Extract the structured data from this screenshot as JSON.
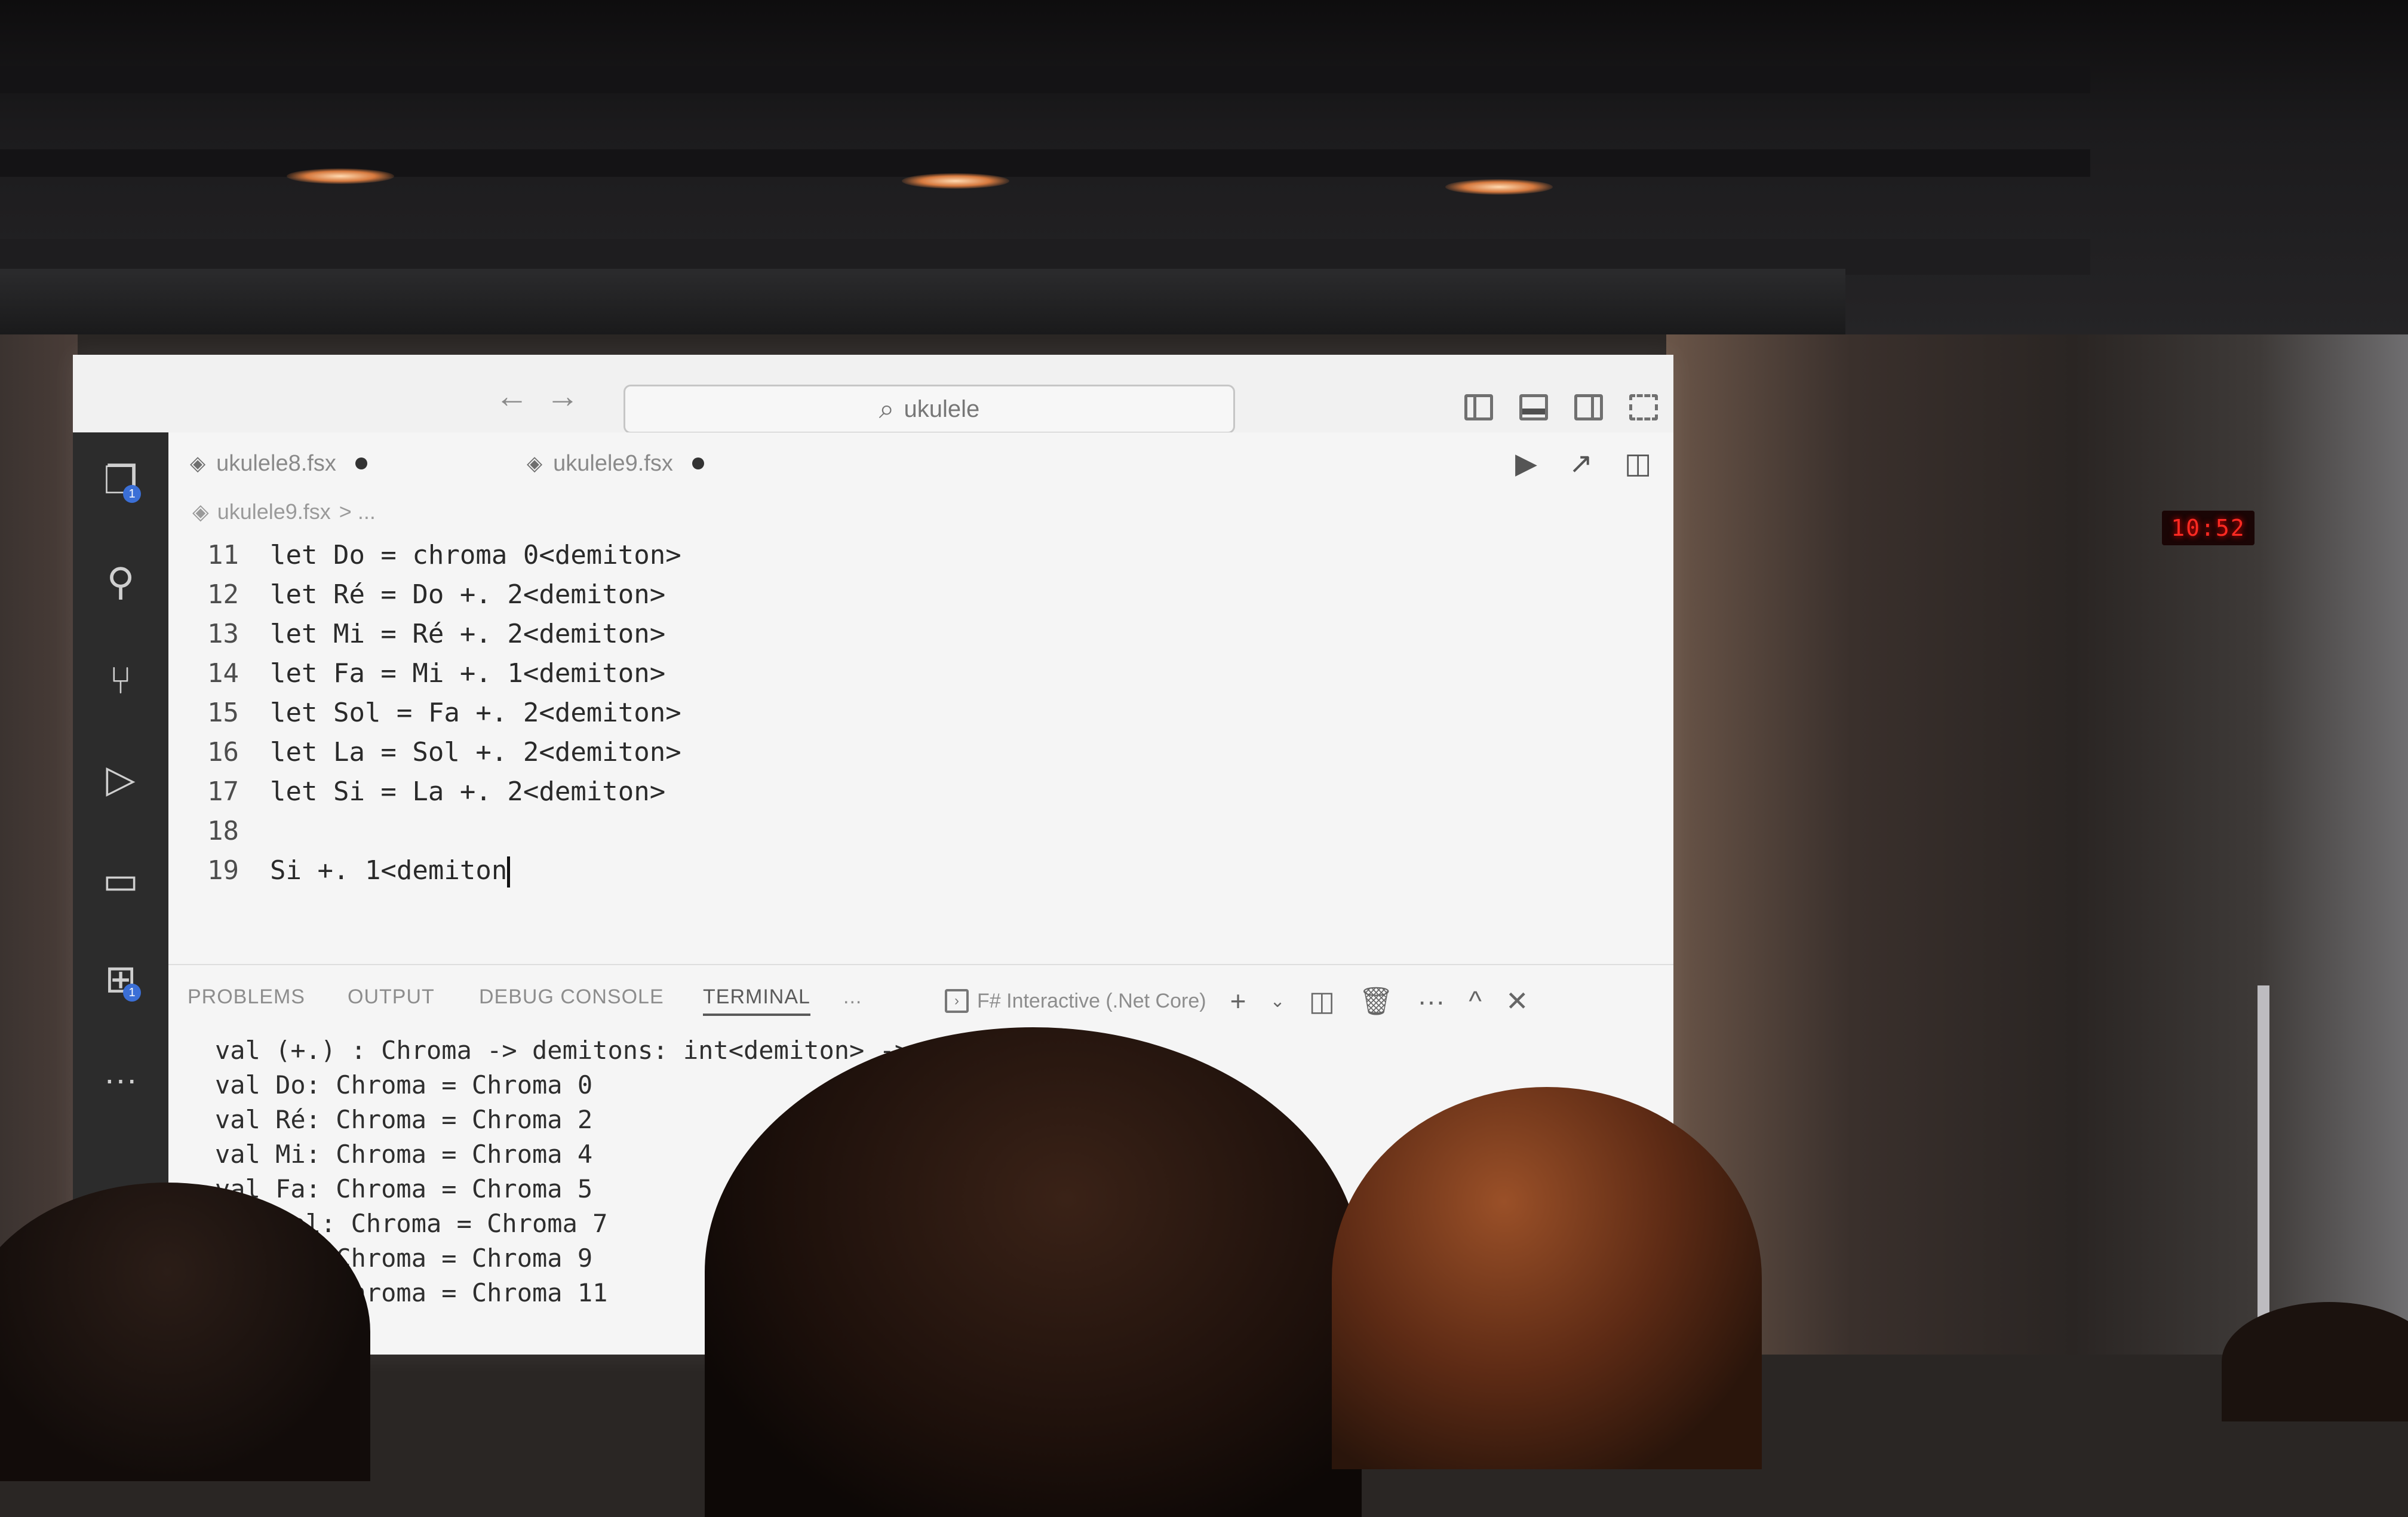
{
  "clock_display": "10:52",
  "titlebar": {
    "back_arrow": "←",
    "forward_arrow": "→",
    "search_text": "ukulele"
  },
  "tabs": [
    {
      "label": "ukulele8.fsx",
      "modified": true
    },
    {
      "label": "ukulele9.fsx",
      "modified": true
    }
  ],
  "breadcrumb": {
    "file": "ukulele9.fsx",
    "separator": "> ..."
  },
  "activity_badges": {
    "explorer": "1",
    "extensions": "1"
  },
  "code_lines": [
    {
      "n": "11",
      "text": "let Do = chroma 0<demiton>"
    },
    {
      "n": "12",
      "text": "let Ré = Do +. 2<demiton>"
    },
    {
      "n": "13",
      "text": "let Mi = Ré +. 2<demiton>"
    },
    {
      "n": "14",
      "text": "let Fa = Mi +. 1<demiton>"
    },
    {
      "n": "15",
      "text": "let Sol = Fa +. 2<demiton>"
    },
    {
      "n": "16",
      "text": "let La = Sol +. 2<demiton>"
    },
    {
      "n": "17",
      "text": "let Si = La +. 2<demiton>"
    },
    {
      "n": "18",
      "text": ""
    },
    {
      "n": "19",
      "text": "Si +. 1<demiton"
    }
  ],
  "panel": {
    "tabs": [
      "PROBLEMS",
      "OUTPUT",
      "DEBUG CONSOLE",
      "TERMINAL",
      "..."
    ],
    "active_tab": "TERMINAL",
    "terminal_name": "F# Interactive (.Net Core)",
    "add": "+",
    "chevron": "⌄",
    "more": "···",
    "maximize": "^",
    "close": "✕"
  },
  "terminal_lines": [
    "val (+.) : Chroma -> demitons: int<demiton> -> C",
    "val Do: Chroma = Chroma 0",
    "val Ré: Chroma = Chroma 2",
    "val Mi: Chroma = Chroma 4",
    "val Fa: Chroma = Chroma 5",
    "val Sol: Chroma = Chroma 7",
    "val La: Chroma = Chroma 9",
    "val Si: Chroma = Chroma 11"
  ],
  "icons": {
    "explorer": "files-icon",
    "search": "search-icon",
    "source_control": "git-branch-icon",
    "run_debug": "run-debug-icon",
    "remote": "remote-explorer-icon",
    "extensions": "extensions-icon"
  }
}
